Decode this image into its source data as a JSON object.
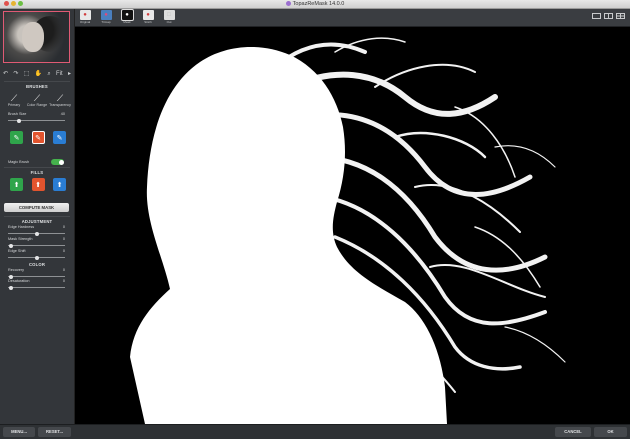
{
  "window": {
    "title": "TopazReMask 14.0.0"
  },
  "toolbar": {
    "tools": [
      "↶",
      "↷",
      "⬚",
      "✋",
      "⌕",
      "↻",
      "▸"
    ],
    "zoom_label": "Fit"
  },
  "brushes": {
    "title": "BRUSHES",
    "items": [
      {
        "label": "Primary",
        "icon": "brush-icon"
      },
      {
        "label": "Color Range",
        "icon": "color-range-icon"
      },
      {
        "label": "Transparency",
        "icon": "transparency-icon"
      }
    ],
    "brush_size_label": "Brush Size",
    "brush_size_value": "40",
    "brush_size_level": 0.2,
    "magic_brush_label": "Magic Brush",
    "magic_brush_on": true
  },
  "fills": {
    "title": "FILLS"
  },
  "compute_label": "COMPUTE MASK",
  "adjustment": {
    "title": "ADJUSTMENT",
    "sliders": [
      {
        "label": "Edge Hardness",
        "value": "0",
        "level": 0.5
      },
      {
        "label": "Mask Strength",
        "value": "0",
        "level": 0.05
      },
      {
        "label": "Edge Shift",
        "value": "0",
        "level": 0.5
      }
    ]
  },
  "color": {
    "title": "COLOR",
    "sliders": [
      {
        "label": "Recovery",
        "value": "0",
        "level": 0.05
      },
      {
        "label": "Desaturation",
        "value": "0",
        "level": 0.05
      }
    ]
  },
  "views": [
    {
      "label": "Original",
      "icon": "apple-color-icon"
    },
    {
      "label": "Trimap",
      "icon": "trimap-icon"
    },
    {
      "label": "Mask",
      "icon": "mask-icon"
    },
    {
      "label": "Stitch",
      "icon": "apple-color-icon"
    },
    {
      "label": "Out",
      "icon": "out-icon"
    }
  ],
  "bottom": {
    "menu": "MENU...",
    "reset": "RESET...",
    "cancel": "CANCEL",
    "ok": "OK"
  },
  "colors": {
    "accent_pink": "#e05a74",
    "green": "#2fa54b",
    "red": "#e2542e",
    "blue": "#2a7dd3"
  }
}
